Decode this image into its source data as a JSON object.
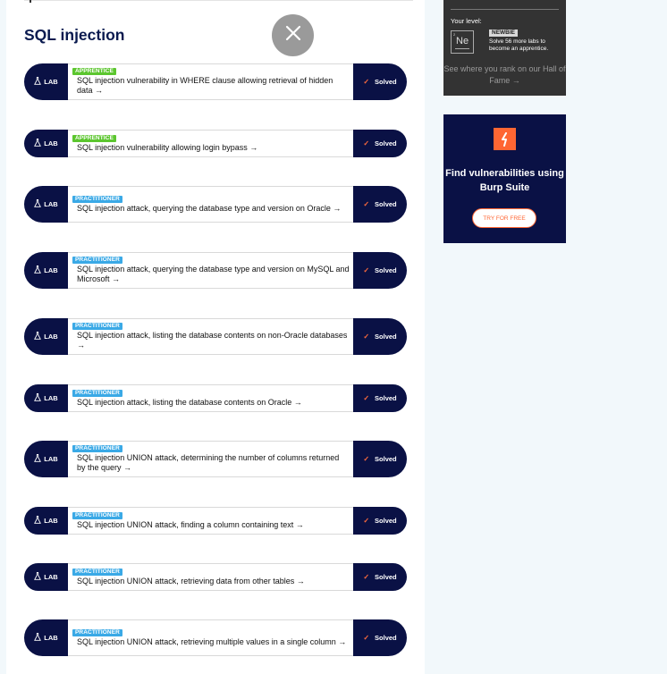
{
  "page": {
    "title": "SQL injection"
  },
  "labs": [
    {
      "tag": "LAB",
      "level": "APPRENTICE",
      "title": "SQL injection vulnerability in WHERE clause allowing retrieval of hidden data →",
      "status": "Solved"
    },
    {
      "tag": "LAB",
      "level": "APPRENTICE",
      "title": "SQL injection vulnerability allowing login bypass →",
      "status": "Solved"
    },
    {
      "tag": "LAB",
      "level": "PRACTITIONER",
      "title": "SQL injection attack, querying the database type and version on Oracle →",
      "status": "Solved"
    },
    {
      "tag": "LAB",
      "level": "PRACTITIONER",
      "title": "SQL injection attack, querying the database type and version on MySQL and Microsoft →",
      "status": "Solved"
    },
    {
      "tag": "LAB",
      "level": "PRACTITIONER",
      "title": "SQL injection attack, listing the database contents on non-Oracle databases →",
      "status": "Solved"
    },
    {
      "tag": "LAB",
      "level": "PRACTITIONER",
      "title": "SQL injection attack, listing the database contents on Oracle →",
      "status": "Solved"
    },
    {
      "tag": "LAB",
      "level": "PRACTITIONER",
      "title": "SQL injection UNION attack, determining the number of columns returned by the query →",
      "status": "Solved"
    },
    {
      "tag": "LAB",
      "level": "PRACTITIONER",
      "title": "SQL injection UNION attack, finding a column containing text →",
      "status": "Solved"
    },
    {
      "tag": "LAB",
      "level": "PRACTITIONER",
      "title": "SQL injection UNION attack, retrieving data from other tables →",
      "status": "Solved"
    },
    {
      "tag": "LAB",
      "level": "PRACTITIONER",
      "title": "SQL injection UNION attack, retrieving multiple values in a single column →",
      "status": "Solved"
    }
  ],
  "level_panel": {
    "label": "Your level:",
    "element_symbol": "Ne",
    "element_number": "2",
    "rank": "NEWBIE",
    "rank_desc": "Solve 56 more labs to become an apprentice.",
    "rank_link": "See where you rank on our Hall of Fame →"
  },
  "burp_ad": {
    "headline": "Find vulnerabilities using Burp Suite",
    "button": "TRY FOR FREE"
  },
  "colors": {
    "navy": "#0a1145",
    "apprentice": "#5cc62f",
    "practitioner": "#3aa9e6",
    "accent": "#ff6633"
  },
  "icons": {
    "close": "close-icon",
    "flask": "flask-icon",
    "check": "check-icon",
    "burp_logo": "burp-logo-icon"
  }
}
